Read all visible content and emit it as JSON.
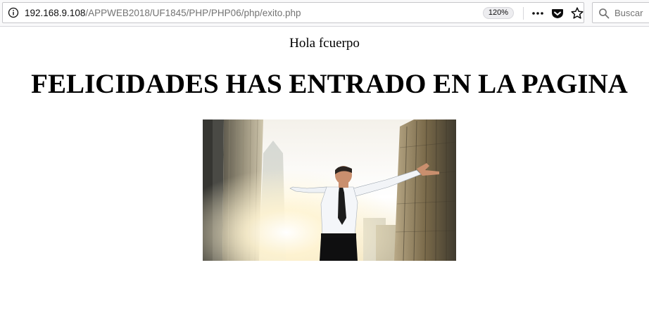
{
  "browser": {
    "url_domain": "192.168.9.108",
    "url_path": "/APPWEB2018/UF1845/PHP/PHP06/php/exito.php",
    "zoom": "120%",
    "search_placeholder": "Buscar",
    "icons": {
      "site_info": "info-icon",
      "more": "more-dots-icon",
      "pocket": "pocket-icon",
      "bookmark": "star-icon",
      "search": "search-icon"
    }
  },
  "page": {
    "greeting": "Hola fcuerpo",
    "headline": "FELICIDADES HAS ENTRADO EN LA PAGINA",
    "image": {
      "subject": "businessman-celebrating-arms-outstretched-city-skyscrapers"
    }
  }
}
